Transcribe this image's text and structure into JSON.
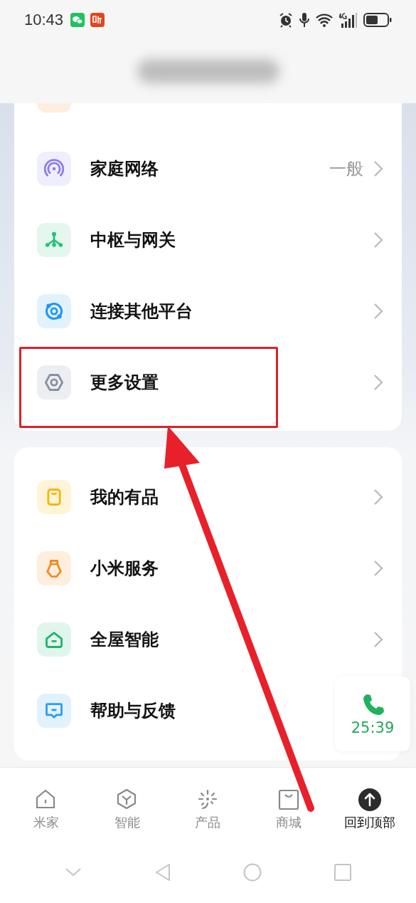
{
  "status_bar": {
    "time": "10:43"
  },
  "menu_groups": [
    {
      "items": [
        {
          "label": "家庭网络",
          "value": "一般"
        },
        {
          "label": "中枢与网关"
        },
        {
          "label": "连接其他平台"
        },
        {
          "label": "更多设置",
          "highlighted": true
        }
      ]
    },
    {
      "items": [
        {
          "label": "我的有品"
        },
        {
          "label": "小米服务"
        },
        {
          "label": "全屋智能"
        },
        {
          "label": "帮助与反馈"
        }
      ]
    }
  ],
  "call_widget": {
    "duration": "25:39"
  },
  "bottom_nav": [
    {
      "label": "米家",
      "selected": false
    },
    {
      "label": "智能",
      "selected": false
    },
    {
      "label": "产品",
      "selected": false
    },
    {
      "label": "商城",
      "selected": false
    },
    {
      "label": "回到顶部",
      "selected": true
    }
  ]
}
